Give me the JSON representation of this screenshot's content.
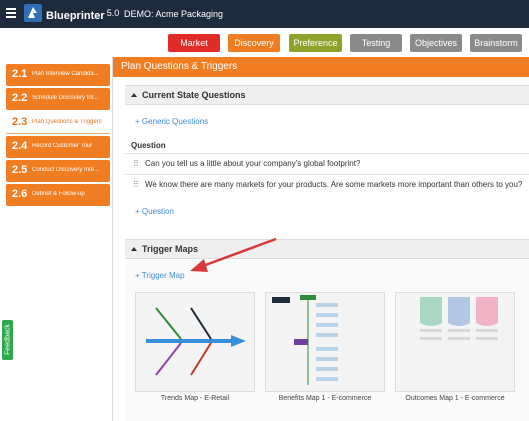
{
  "app": {
    "name": "Blueprinter",
    "version": "5.0",
    "demo_label": "DEMO: Acme Packaging"
  },
  "stage_tabs": [
    {
      "label": "Market",
      "color": "#e02b27"
    },
    {
      "label": "Discovery",
      "color": "#f07d22"
    },
    {
      "label": "Preference",
      "color": "#8fa32a"
    },
    {
      "label": "Testing",
      "color": "#8a8a8a"
    },
    {
      "label": "Objectives",
      "color": "#8a8a8a"
    },
    {
      "label": "Brainstorm",
      "color": "#8a8a8a"
    }
  ],
  "steps": [
    {
      "num": "2.1",
      "label": "Plan Interview Candida..."
    },
    {
      "num": "2.2",
      "label": "Schedule Discovery Int..."
    },
    {
      "num": "2.3",
      "label": "Plan Questions & Triggers"
    },
    {
      "num": "2.4",
      "label": "Record Customer Tour"
    },
    {
      "num": "2.5",
      "label": "Conduct Discovery Inte..."
    },
    {
      "num": "2.6",
      "label": "Debrief & Follow-up"
    }
  ],
  "feedback_label": "Feedback",
  "main": {
    "title": "Plan Questions & Triggers",
    "current_state": {
      "heading": "Current State Questions",
      "generic_link": "+ Generic Questions",
      "column_header": "Question",
      "questions": [
        "Can you tell us a little about your company's global footprint?",
        "We know there are many markets for your products. Are some markets more important than others to you?"
      ],
      "add_link": "+ Question"
    },
    "trigger_maps": {
      "heading": "Trigger Maps",
      "add_link": "+ Trigger Map",
      "maps": [
        {
          "caption": "Trends Map - E-Retail"
        },
        {
          "caption": "Benefits Map 1 - E-commerce"
        },
        {
          "caption": "Outcomes Map 1 - E-commerce"
        }
      ]
    }
  },
  "colors": {
    "accent": "#f07d22",
    "topbar": "#1e2b3c",
    "link": "#3a8fd9",
    "annotation_arrow": "#d9383a"
  }
}
